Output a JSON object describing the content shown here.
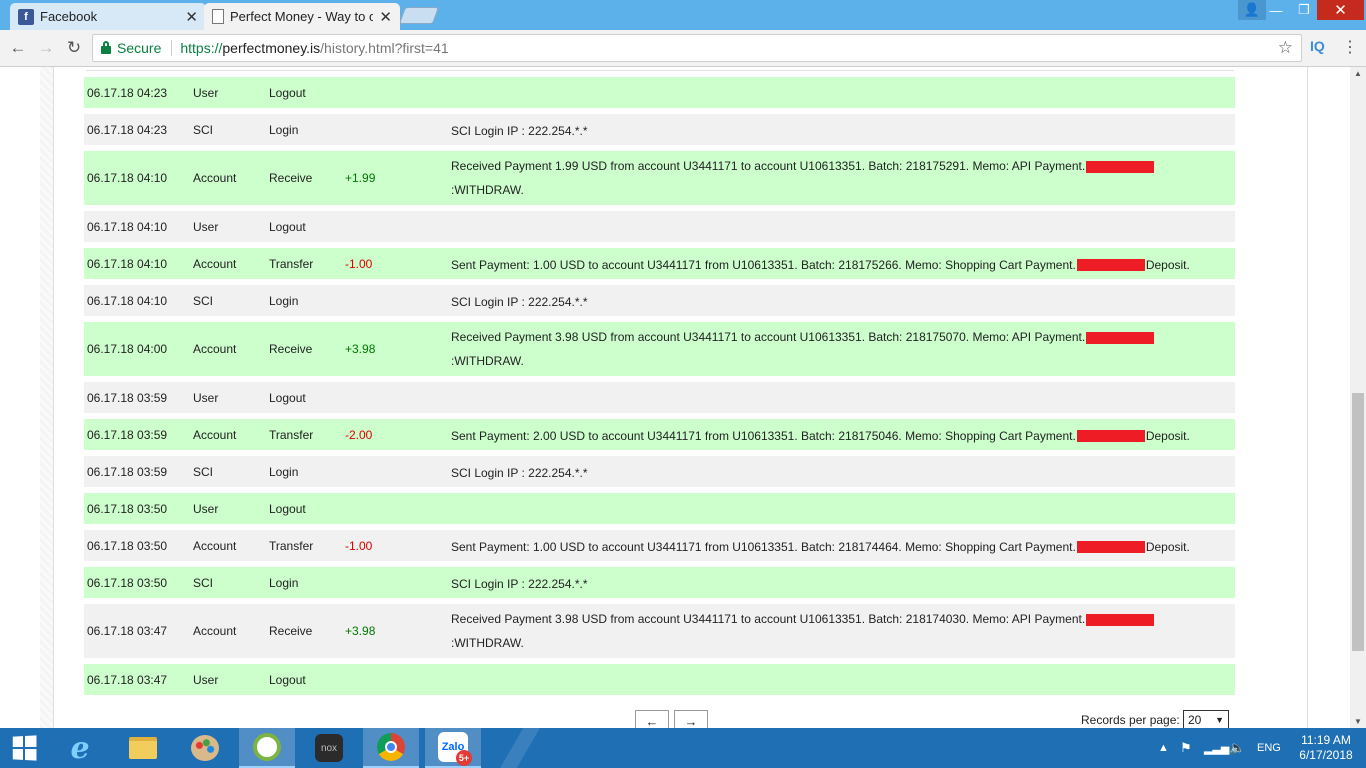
{
  "browser": {
    "tabs": [
      {
        "title": "Facebook",
        "icon": "facebook-icon",
        "active": false
      },
      {
        "title": "Perfect Money - Way to o",
        "icon": "document-icon",
        "active": true
      }
    ],
    "secure_label": "Secure",
    "url_scheme": "https://",
    "url_host": "perfectmoney.is",
    "url_path": "/history.html?first=41",
    "extension_label": "IQ"
  },
  "history": {
    "rows": [
      {
        "date": "06.17.18 04:23",
        "type": "User",
        "action": "Logout",
        "amount": "",
        "sign": "",
        "desc": "",
        "desc2": "",
        "redact": "",
        "color": "g"
      },
      {
        "date": "06.17.18 04:23",
        "type": "SCI",
        "action": "Login",
        "amount": "",
        "sign": "",
        "desc": "SCI Login IP : 222.254.*.*",
        "desc2": "",
        "redact": "",
        "color": "w"
      },
      {
        "date": "06.17.18 04:10",
        "type": "Account",
        "action": "Receive",
        "amount": "+1.99",
        "sign": "pos",
        "desc": "Received Payment 1.99 USD from account U3441171 to account U10613351. Batch: 218175291. Memo: API Payment.",
        "desc2": ":WITHDRAW.",
        "redact": "end",
        "color": "g"
      },
      {
        "date": "06.17.18 04:10",
        "type": "User",
        "action": "Logout",
        "amount": "",
        "sign": "",
        "desc": "",
        "desc2": "",
        "redact": "",
        "color": "w"
      },
      {
        "date": "06.17.18 04:10",
        "type": "Account",
        "action": "Transfer",
        "amount": "-1.00",
        "sign": "neg",
        "desc": "Sent Payment: 1.00 USD to account U3441171 from U10613351. Batch: 218175266. Memo: Shopping Cart Payment.",
        "desc2": "Deposit.",
        "redact": "mid",
        "color": "g"
      },
      {
        "date": "06.17.18 04:10",
        "type": "SCI",
        "action": "Login",
        "amount": "",
        "sign": "",
        "desc": "SCI Login IP : 222.254.*.*",
        "desc2": "",
        "redact": "",
        "color": "w"
      },
      {
        "date": "06.17.18 04:00",
        "type": "Account",
        "action": "Receive",
        "amount": "+3.98",
        "sign": "pos",
        "desc": "Received Payment 3.98 USD from account U3441171 to account U10613351. Batch: 218175070. Memo: API Payment.",
        "desc2": ":WITHDRAW.",
        "redact": "end",
        "color": "g"
      },
      {
        "date": "06.17.18 03:59",
        "type": "User",
        "action": "Logout",
        "amount": "",
        "sign": "",
        "desc": "",
        "desc2": "",
        "redact": "",
        "color": "w"
      },
      {
        "date": "06.17.18 03:59",
        "type": "Account",
        "action": "Transfer",
        "amount": "-2.00",
        "sign": "neg",
        "desc": "Sent Payment: 2.00 USD to account U3441171 from U10613351. Batch: 218175046. Memo: Shopping Cart Payment.",
        "desc2": "Deposit.",
        "redact": "mid",
        "color": "g"
      },
      {
        "date": "06.17.18 03:59",
        "type": "SCI",
        "action": "Login",
        "amount": "",
        "sign": "",
        "desc": "SCI Login IP : 222.254.*.*",
        "desc2": "",
        "redact": "",
        "color": "w"
      },
      {
        "date": "06.17.18 03:50",
        "type": "User",
        "action": "Logout",
        "amount": "",
        "sign": "",
        "desc": "",
        "desc2": "",
        "redact": "",
        "color": "g"
      },
      {
        "date": "06.17.18 03:50",
        "type": "Account",
        "action": "Transfer",
        "amount": "-1.00",
        "sign": "neg",
        "desc": "Sent Payment: 1.00 USD to account U3441171 from U10613351. Batch: 218174464. Memo: Shopping Cart Payment.",
        "desc2": "Deposit.",
        "redact": "mid",
        "color": "w"
      },
      {
        "date": "06.17.18 03:50",
        "type": "SCI",
        "action": "Login",
        "amount": "",
        "sign": "",
        "desc": "SCI Login IP : 222.254.*.*",
        "desc2": "",
        "redact": "",
        "color": "g"
      },
      {
        "date": "06.17.18 03:47",
        "type": "Account",
        "action": "Receive",
        "amount": "+3.98",
        "sign": "pos",
        "desc": "Received Payment 3.98 USD from account U3441171 to account U10613351. Batch: 218174030. Memo: API Payment.",
        "desc2": ":WITHDRAW.",
        "redact": "end",
        "color": "w"
      },
      {
        "date": "06.17.18 03:47",
        "type": "User",
        "action": "Logout",
        "amount": "",
        "sign": "",
        "desc": "",
        "desc2": "",
        "redact": "",
        "color": "g"
      }
    ],
    "pager": {
      "prev_label": "←",
      "next_label": "→",
      "records_label": "Records per page:",
      "records_value": "20"
    }
  },
  "colors": {
    "row_green": "#ccffcc",
    "row_gray": "#f1f1f1",
    "positive": "#007700",
    "negative": "#dd0000",
    "redaction": "#ee1c25"
  },
  "taskbar": {
    "apps": [
      "windows-start-icon",
      "internet-explorer-icon",
      "file-explorer-icon",
      "paint-icon",
      "coccoc-icon",
      "nox-icon",
      "chrome-icon",
      "zalo-icon"
    ],
    "nox_label": "nox",
    "zalo_label": "Zalo",
    "zalo_badge": "5+",
    "lang": "ENG",
    "time": "11:19 AM",
    "date": "6/17/2018"
  }
}
